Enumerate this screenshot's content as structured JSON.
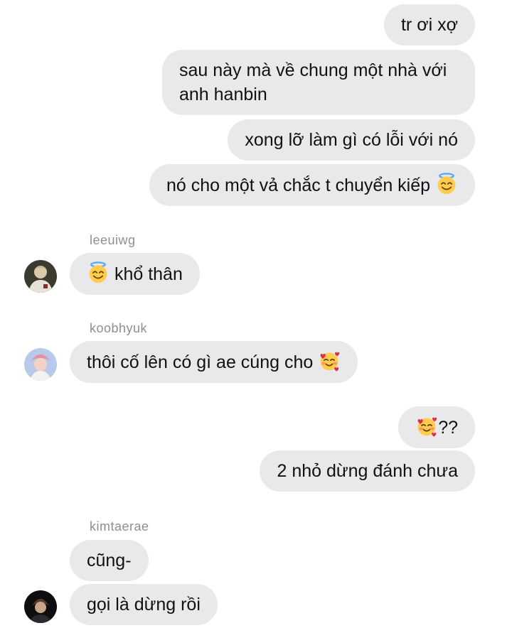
{
  "messages": [
    {
      "id": "m1",
      "dir": "out",
      "text": "tr ơi xợ"
    },
    {
      "id": "m2",
      "dir": "out",
      "text": "sau này mà về chung một nhà với anh hanbin"
    },
    {
      "id": "m3",
      "dir": "out",
      "text": "xong lỡ làm gì có lỗi với nó"
    },
    {
      "id": "m4",
      "dir": "out",
      "text": "nó cho một vả chắc t chuyển kiếp",
      "emoji": "smiling-face-with-halo"
    },
    {
      "id": "m5",
      "dir": "in",
      "sender": "leeuiwg",
      "emoji": "smiling-face-with-halo",
      "text": "khổ thân"
    },
    {
      "id": "m6",
      "dir": "in",
      "sender": "koobhyuk",
      "text": "thôi cố lên có gì ae cúng cho",
      "emoji": "smiling-face-with-hearts"
    },
    {
      "id": "m7",
      "dir": "out",
      "emoji": "smiling-face-with-hearts",
      "text": "??"
    },
    {
      "id": "m8",
      "dir": "out",
      "text": "2 nhỏ dừng đánh chưa"
    },
    {
      "id": "m9",
      "dir": "in",
      "sender": "kimtaerae",
      "text": "cũng-"
    },
    {
      "id": "m10",
      "dir": "in",
      "text": "gọi là dừng rồi"
    }
  ],
  "senders": {
    "leeuiwg": "leeuiwg",
    "koobhyuk": "koobhyuk",
    "kimtaerae": "kimtaerae"
  },
  "colors": {
    "bubble": "#e9e9eb",
    "text": "#111111",
    "sender": "#8e8e93"
  }
}
